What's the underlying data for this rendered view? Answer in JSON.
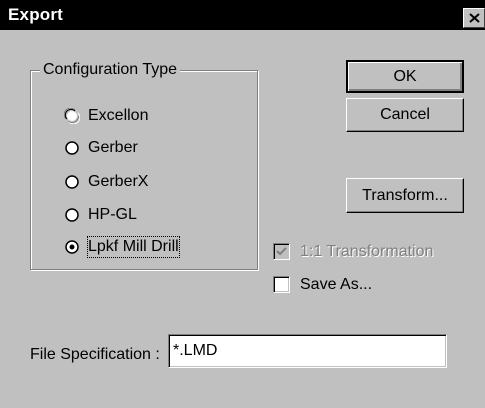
{
  "window": {
    "title": "Export"
  },
  "config_group": {
    "legend": "Configuration Type",
    "options": [
      {
        "label": "Excellon",
        "selected": false
      },
      {
        "label": "Gerber",
        "selected": false
      },
      {
        "label": "GerberX",
        "selected": false
      },
      {
        "label": "HP-GL",
        "selected": false
      },
      {
        "label": "Lpkf Mill Drill",
        "selected": true
      }
    ]
  },
  "buttons": {
    "ok": "OK",
    "cancel": "Cancel",
    "transform": "Transform..."
  },
  "checkboxes": {
    "transformation": {
      "label": "1:1 Transformation",
      "checked": true,
      "enabled": false
    },
    "save_as": {
      "label": "Save As...",
      "checked": false,
      "enabled": true
    }
  },
  "file_spec": {
    "label": "File Specification :",
    "value": "*.LMD"
  }
}
